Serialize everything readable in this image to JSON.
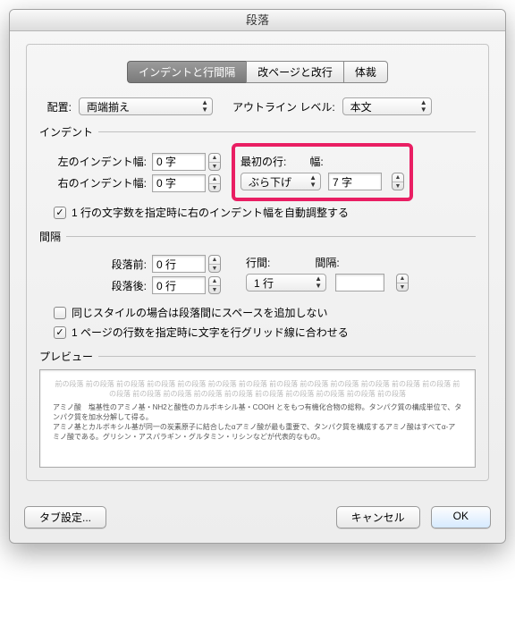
{
  "title": "段落",
  "tabs": {
    "t1": "インデントと行間隔",
    "t2": "改ページと改行",
    "t3": "体裁",
    "selected": 0
  },
  "alignment": {
    "label": "配置:",
    "value": "両端揃え"
  },
  "outline": {
    "label": "アウトライン レベル:",
    "value": "本文"
  },
  "indent": {
    "group": "インデント",
    "left_label": "左のインデント幅:",
    "left_value": "0 字",
    "right_label": "右のインデント幅:",
    "right_value": "0 字",
    "firstline_label": "最初の行:",
    "firstline_value": "ぶら下げ",
    "width_label": "幅:",
    "width_value": "7 字",
    "autoadjust": "1 行の文字数を指定時に右のインデント幅を自動調整する"
  },
  "spacing": {
    "group": "間隔",
    "before_label": "段落前:",
    "before_value": "0 行",
    "after_label": "段落後:",
    "after_value": "0 行",
    "lineheight_label": "行間:",
    "lineheight_value": "1 行",
    "gap_label": "間隔:",
    "gap_value": "",
    "nospace": "同じスタイルの場合は段落間にスペースを追加しない",
    "snapgrid": "1 ページの行数を指定時に文字を行グリッド線に合わせる"
  },
  "preview": {
    "label": "プレビュー",
    "filler": "前の段落 前の段落 前の段落 前の段落 前の段落 前の段落 前の段落 前の段落 前の段落 前の段落 前の段落 前の段落 前の段落 前の段落 前の段落 前の段落 前の段落 前の段落 前の段落 前の段落 前の段落 前の段落 前の段落",
    "sample": "アミノ酸　塩基性のアミノ基・NH2と酸性のカルボキシル基・COOH とをもつ有機化合物の総称。タンパク質の構成単位で、タンパク質を加水分解して得る。\nアミノ基とカルボキシル基が同一の炭素原子に結合したαアミノ酸が最も重要で、タンパク質を構成するアミノ酸はすべてα-アミノ酸である。グリシン・アスパラギン・グルタミン・リシンなどが代表的なもの。"
  },
  "buttons": {
    "tabs": "タブ設定...",
    "cancel": "キャンセル",
    "ok": "OK"
  }
}
